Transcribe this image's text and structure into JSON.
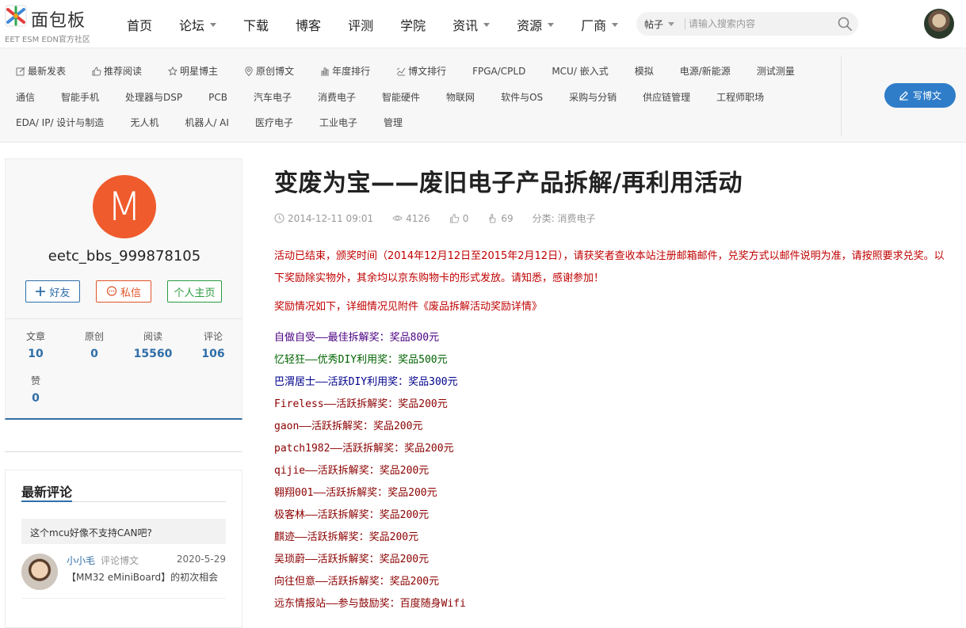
{
  "site": {
    "logo_text": "面包板",
    "logo_sub": "EET ESM EDN官方社区"
  },
  "nav": {
    "items": [
      {
        "label": "首页",
        "dropdown": false
      },
      {
        "label": "论坛",
        "dropdown": true
      },
      {
        "label": "下载",
        "dropdown": false
      },
      {
        "label": "博客",
        "dropdown": false
      },
      {
        "label": "评测",
        "dropdown": false
      },
      {
        "label": "学院",
        "dropdown": false
      },
      {
        "label": "资讯",
        "dropdown": true
      },
      {
        "label": "资源",
        "dropdown": true
      },
      {
        "label": "厂商",
        "dropdown": true
      }
    ]
  },
  "search": {
    "type_label": "帖子",
    "placeholder": "请输入搜索内容"
  },
  "categories": {
    "row1": [
      "最新发表",
      "推荐阅读",
      "明星博主",
      "原创博文",
      "年度排行",
      "博文排行",
      "FPGA/CPLD",
      "MCU/ 嵌入式",
      "模拟",
      "电源/新能源",
      "测试测量"
    ],
    "row2": [
      "通信",
      "智能手机",
      "处理器与DSP",
      "PCB",
      "汽车电子",
      "消费电子",
      "智能硬件",
      "物联网",
      "软件与OS",
      "采购与分销",
      "供应链管理",
      "工程师职场"
    ],
    "row3": [
      "EDA/ IP/ 设计与制造",
      "无人机",
      "机器人/ AI",
      "医疗电子",
      "工业电子",
      "管理"
    ],
    "row1_icons": [
      "edit-icon",
      "thumb-icon",
      "star-icon",
      "pin-icon",
      "rank-icon",
      "chart-icon"
    ],
    "write_label": "写博文"
  },
  "profile": {
    "avatar_letter": "M",
    "username": "eetc_bbs_999878105",
    "friend_label": "好友",
    "message_label": "私信",
    "home_label": "个人主页",
    "stats": [
      {
        "label": "文章",
        "value": "10"
      },
      {
        "label": "原创",
        "value": "0"
      },
      {
        "label": "阅读",
        "value": "15560"
      },
      {
        "label": "评论",
        "value": "106"
      },
      {
        "label": "赞",
        "value": "0"
      }
    ]
  },
  "comments": {
    "title": "最新评论",
    "items": [
      {
        "quote": "这个mcu好像不支持CAN吧?",
        "user": "小小毛",
        "action": "评论博文",
        "date": "2020-5-29",
        "article": "【MM32 eMiniBoard】的初次相会"
      }
    ]
  },
  "article": {
    "title": "变废为宝——废旧电子产品拆解/再利用活动",
    "date": "2014-12-11 09:01",
    "views": "4126",
    "likes": "0",
    "favorites": "69",
    "category": "分类: 消费电子",
    "intro": "活动已结束，颁奖时间（2014年12月12日至2015年2月12日），请获奖者查收本站注册邮箱邮件，兑奖方式以邮件说明为准，请按照要求兑奖。以下奖励除实物外，其余均以京东购物卡的形式发放。请知悉，感谢参加！",
    "detail": "奖励情况如下，详细情况见附件《废品拆解活动奖励详情》",
    "winners": [
      {
        "text": "自做自受——最佳拆解奖：奖品800元",
        "color": "#4b0082"
      },
      {
        "text": "忆轻狂——优秀DIY利用奖：奖品500元",
        "color": "#006400"
      },
      {
        "text": "巴渭居士——活跃DIY利用奖：奖品300元",
        "color": "#00008b"
      },
      {
        "text": "Fireless——活跃拆解奖：奖品200元",
        "color": "#8b0000"
      },
      {
        "text": "gaon——活跃拆解奖：奖品200元",
        "color": "#8b0000"
      },
      {
        "text": "patch1982——活跃拆解奖：奖品200元",
        "color": "#8b0000"
      },
      {
        "text": "qijie——活跃拆解奖：奖品200元",
        "color": "#8b0000"
      },
      {
        "text": "翱翔001——活跃拆解奖：奖品200元",
        "color": "#8b0000"
      },
      {
        "text": "极客林——活跃拆解奖：奖品200元",
        "color": "#8b0000"
      },
      {
        "text": "麒迹——活跃拆解奖：奖品200元",
        "color": "#8b0000"
      },
      {
        "text": "吴琐蔚——活跃拆解奖：奖品200元",
        "color": "#8b0000"
      },
      {
        "text": "向往但意——活跃拆解奖：奖品200元",
        "color": "#8b0000"
      },
      {
        "text": "远东情报站——参与鼓励奖：百度随身Wifi",
        "color": "#8b0000"
      }
    ]
  },
  "colors": {
    "accent": "#2f6ea8",
    "write_button": "#2f7dc9",
    "avatar_bg": "#ef5b2d",
    "alert_red": "#c00000"
  }
}
